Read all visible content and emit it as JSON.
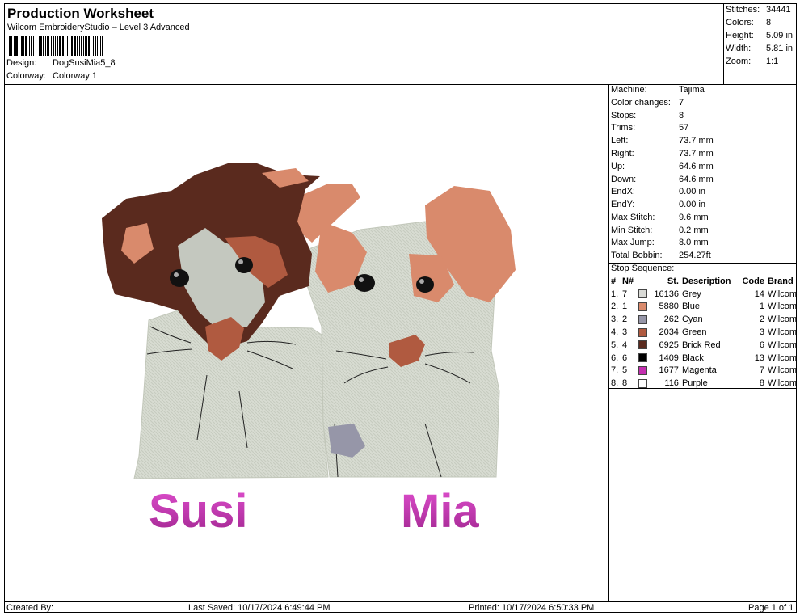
{
  "header": {
    "title": "Production Worksheet",
    "subtitle": "Wilcom EmbroideryStudio – Level 3 Advanced",
    "design_label": "Design:",
    "design_value": "DogSusiMia5_8",
    "colorway_label": "Colorway:",
    "colorway_value": "Colorway 1"
  },
  "stats": [
    {
      "label": "Stitches:",
      "value": "34441"
    },
    {
      "label": "Colors:",
      "value": "8"
    },
    {
      "label": "Height:",
      "value": "5.09 in"
    },
    {
      "label": "Width:",
      "value": "5.81 in"
    },
    {
      "label": "Zoom:",
      "value": "1:1"
    }
  ],
  "machine": [
    {
      "label": "Machine:",
      "value": "Tajima"
    },
    {
      "label": "Color changes:",
      "value": "7"
    },
    {
      "label": "Stops:",
      "value": "8"
    },
    {
      "label": "Trims:",
      "value": "57"
    },
    {
      "label": "Left:",
      "value": "73.7 mm"
    },
    {
      "label": "Right:",
      "value": "73.7 mm"
    },
    {
      "label": "Up:",
      "value": "64.6 mm"
    },
    {
      "label": "Down:",
      "value": "64.6 mm"
    },
    {
      "label": "EndX:",
      "value": "0.00 in"
    },
    {
      "label": "EndY:",
      "value": "0.00 in"
    },
    {
      "label": "Max Stitch:",
      "value": "9.6 mm"
    },
    {
      "label": "Min Stitch:",
      "value": "0.2 mm"
    },
    {
      "label": "Max Jump:",
      "value": "8.0 mm"
    },
    {
      "label": "Total Bobbin:",
      "value": "254.27ft"
    }
  ],
  "stop_sequence": {
    "title": "Stop Sequence:",
    "headers": [
      "#",
      "N#",
      "St.",
      "Description",
      "Code",
      "Brand"
    ],
    "rows": [
      {
        "num": "1.",
        "n": "7",
        "color": "#d9dad6",
        "st": "16136",
        "desc": "Grey",
        "code": "14",
        "brand": "Wilcom"
      },
      {
        "num": "2.",
        "n": "1",
        "color": "#d98a6c",
        "st": "5880",
        "desc": "Blue",
        "code": "1",
        "brand": "Wilcom"
      },
      {
        "num": "3.",
        "n": "2",
        "color": "#9696a8",
        "st": "262",
        "desc": "Cyan",
        "code": "2",
        "brand": "Wilcom"
      },
      {
        "num": "4.",
        "n": "3",
        "color": "#b05a40",
        "st": "2034",
        "desc": "Green",
        "code": "3",
        "brand": "Wilcom"
      },
      {
        "num": "5.",
        "n": "4",
        "color": "#5a2a1e",
        "st": "6925",
        "desc": "Brick Red",
        "code": "6",
        "brand": "Wilcom"
      },
      {
        "num": "6.",
        "n": "6",
        "color": "#000000",
        "st": "1409",
        "desc": "Black",
        "code": "13",
        "brand": "Wilcom"
      },
      {
        "num": "7.",
        "n": "5",
        "color": "#c42fb0",
        "st": "1677",
        "desc": "Magenta",
        "code": "7",
        "brand": "Wilcom"
      },
      {
        "num": "8.",
        "n": "8",
        "color": "#ffffff",
        "st": "116",
        "desc": "Purple",
        "code": "8",
        "brand": "Wilcom"
      }
    ]
  },
  "design_text": {
    "left_name": "Susi",
    "right_name": "Mia"
  },
  "footer": {
    "created": "Created By:",
    "last_saved": "Last Saved: 10/17/2024 6:49:44 PM",
    "printed": "Printed: 10/17/2024 6:50:33 PM",
    "page": "Page 1 of 1"
  }
}
